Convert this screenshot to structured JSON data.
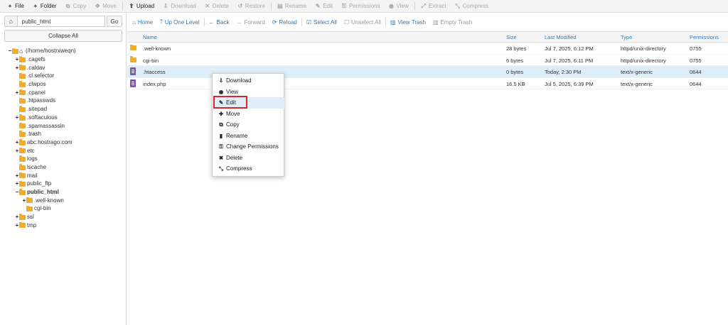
{
  "toolbar": {
    "items": [
      {
        "label": "File",
        "icon": "plus-icon",
        "glyph": "+",
        "enabled": true
      },
      {
        "label": "Folder",
        "icon": "plus-icon",
        "glyph": "+",
        "enabled": true
      },
      {
        "label": "Copy",
        "icon": "copy-icon",
        "glyph": "⧉",
        "enabled": false
      },
      {
        "label": "Move",
        "icon": "move-icon",
        "glyph": "✥",
        "enabled": false
      },
      {
        "label": "Upload",
        "icon": "upload-icon",
        "glyph": "⇪",
        "enabled": true
      },
      {
        "label": "Download",
        "icon": "download-icon",
        "glyph": "⇩",
        "enabled": false
      },
      {
        "label": "Delete",
        "icon": "delete-icon",
        "glyph": "✕",
        "enabled": false
      },
      {
        "label": "Restore",
        "icon": "restore-icon",
        "glyph": "↺",
        "enabled": false
      },
      {
        "label": "Rename",
        "icon": "rename-icon",
        "glyph": "▤",
        "enabled": false
      },
      {
        "label": "Edit",
        "icon": "edit-icon",
        "glyph": "✎",
        "enabled": false
      },
      {
        "label": "Permissions",
        "icon": "key-icon",
        "glyph": "⚿",
        "enabled": false
      },
      {
        "label": "View",
        "icon": "eye-icon",
        "glyph": "◉",
        "enabled": false
      },
      {
        "label": "Extract",
        "icon": "extract-icon",
        "glyph": "⤢",
        "enabled": false
      },
      {
        "label": "Compress",
        "icon": "compress-icon",
        "glyph": "⤡",
        "enabled": false
      }
    ]
  },
  "left": {
    "path_value": "public_html",
    "go_label": "Go",
    "collapse_label": "Collapse All",
    "tree": [
      {
        "label": "(/home/hostrxweqn)",
        "toggle": "−",
        "depth": 0,
        "home": true,
        "bold": false
      },
      {
        "label": ".cagefs",
        "toggle": "+",
        "depth": 1,
        "bold": false
      },
      {
        "label": ".caldav",
        "toggle": "+",
        "depth": 1,
        "bold": false
      },
      {
        "label": ".cl.selector",
        "toggle": "",
        "depth": 1,
        "bold": false
      },
      {
        "label": ".clwpos",
        "toggle": "",
        "depth": 1,
        "bold": false
      },
      {
        "label": ".cpanel",
        "toggle": "+",
        "depth": 1,
        "bold": false
      },
      {
        "label": ".htpasswds",
        "toggle": "",
        "depth": 1,
        "bold": false
      },
      {
        "label": ".sitepad",
        "toggle": "",
        "depth": 1,
        "bold": false
      },
      {
        "label": ".softaculous",
        "toggle": "+",
        "depth": 1,
        "bold": false
      },
      {
        "label": ".spamassassin",
        "toggle": "",
        "depth": 1,
        "bold": false
      },
      {
        "label": ".trash",
        "toggle": "",
        "depth": 1,
        "bold": false
      },
      {
        "label": "abc.hostrago.com",
        "toggle": "+",
        "depth": 1,
        "bold": false
      },
      {
        "label": "etc",
        "toggle": "+",
        "depth": 1,
        "bold": false
      },
      {
        "label": "logs",
        "toggle": "",
        "depth": 1,
        "bold": false
      },
      {
        "label": "lscache",
        "toggle": "",
        "depth": 1,
        "bold": false
      },
      {
        "label": "mail",
        "toggle": "+",
        "depth": 1,
        "bold": false
      },
      {
        "label": "public_ftp",
        "toggle": "+",
        "depth": 1,
        "bold": false
      },
      {
        "label": "public_html",
        "toggle": "−",
        "depth": 1,
        "bold": true
      },
      {
        "label": ".well-known",
        "toggle": "+",
        "depth": 2,
        "bold": false
      },
      {
        "label": "cgi-bin",
        "toggle": "",
        "depth": 2,
        "bold": false
      },
      {
        "label": "ssl",
        "toggle": "+",
        "depth": 1,
        "bold": false
      },
      {
        "label": "tmp",
        "toggle": "+",
        "depth": 1,
        "bold": false
      }
    ]
  },
  "nav": {
    "items": [
      {
        "label": "Home",
        "glyph": "⌂",
        "icon": "home-icon",
        "enabled": true
      },
      {
        "label": "Up One Level",
        "glyph": "⤒",
        "icon": "up-level-icon",
        "enabled": true
      },
      {
        "label": "Back",
        "glyph": "←",
        "icon": "back-arrow-icon",
        "enabled": true
      },
      {
        "label": "Forward",
        "glyph": "→",
        "icon": "forward-arrow-icon",
        "enabled": false
      },
      {
        "label": "Reload",
        "glyph": "⟳",
        "icon": "reload-icon",
        "enabled": true
      },
      {
        "label": "Select All",
        "glyph": "☑",
        "icon": "checkbox-checked-icon",
        "enabled": true
      },
      {
        "label": "Unselect All",
        "glyph": "☐",
        "icon": "checkbox-empty-icon",
        "enabled": false
      },
      {
        "label": "View Trash",
        "glyph": "▥",
        "icon": "trash-icon",
        "enabled": true
      },
      {
        "label": "Empty Trash",
        "glyph": "▥",
        "icon": "trash-icon",
        "enabled": false
      }
    ]
  },
  "table": {
    "headers": {
      "name": "Name",
      "size": "Size",
      "modified": "Last Modified",
      "type": "Type",
      "perms": "Permissions"
    },
    "rows": [
      {
        "name": ".well-known",
        "size": "28 bytes",
        "modified": "Jul 7, 2025, 6:12 PM",
        "type": "httpd/unix-directory",
        "perms": "0755",
        "kind": "folder",
        "selected": false
      },
      {
        "name": "cgi-bin",
        "size": "6 bytes",
        "modified": "Jul 7, 2025, 6:11 PM",
        "type": "httpd/unix-directory",
        "perms": "0755",
        "kind": "folder",
        "selected": false
      },
      {
        "name": ".htaccess",
        "size": "0 bytes",
        "modified": "Today, 2:30 PM",
        "type": "text/x-generic",
        "perms": "0644",
        "kind": "file",
        "selected": true
      },
      {
        "name": "index.php",
        "size": "16.5 KB",
        "modified": "Jul 5, 2025, 6:39 PM",
        "type": "text/x-generic",
        "perms": "0644",
        "kind": "file",
        "selected": false
      }
    ]
  },
  "context_menu": {
    "items": [
      {
        "label": "Download",
        "glyph": "⇩",
        "icon": "download-icon"
      },
      {
        "label": "View",
        "glyph": "◉",
        "icon": "eye-icon"
      },
      {
        "label": "Edit",
        "glyph": "✎",
        "icon": "pencil-icon",
        "highlighted": true
      },
      {
        "label": "Move",
        "glyph": "✚",
        "icon": "move-icon"
      },
      {
        "label": "Copy",
        "glyph": "⧉",
        "icon": "copy-icon"
      },
      {
        "label": "Rename",
        "glyph": "▮",
        "icon": "rename-icon"
      },
      {
        "label": "Change Permissions",
        "glyph": "⚿",
        "icon": "key-icon"
      },
      {
        "label": "Delete",
        "glyph": "✖",
        "icon": "delete-icon"
      },
      {
        "label": "Compress",
        "glyph": "⤡",
        "icon": "compress-icon"
      }
    ]
  },
  "colors": {
    "link": "#2a7bbf",
    "folder": "#f0ad2c",
    "selected_row": "#ddeef9",
    "highlight_border": "#d9262a"
  }
}
